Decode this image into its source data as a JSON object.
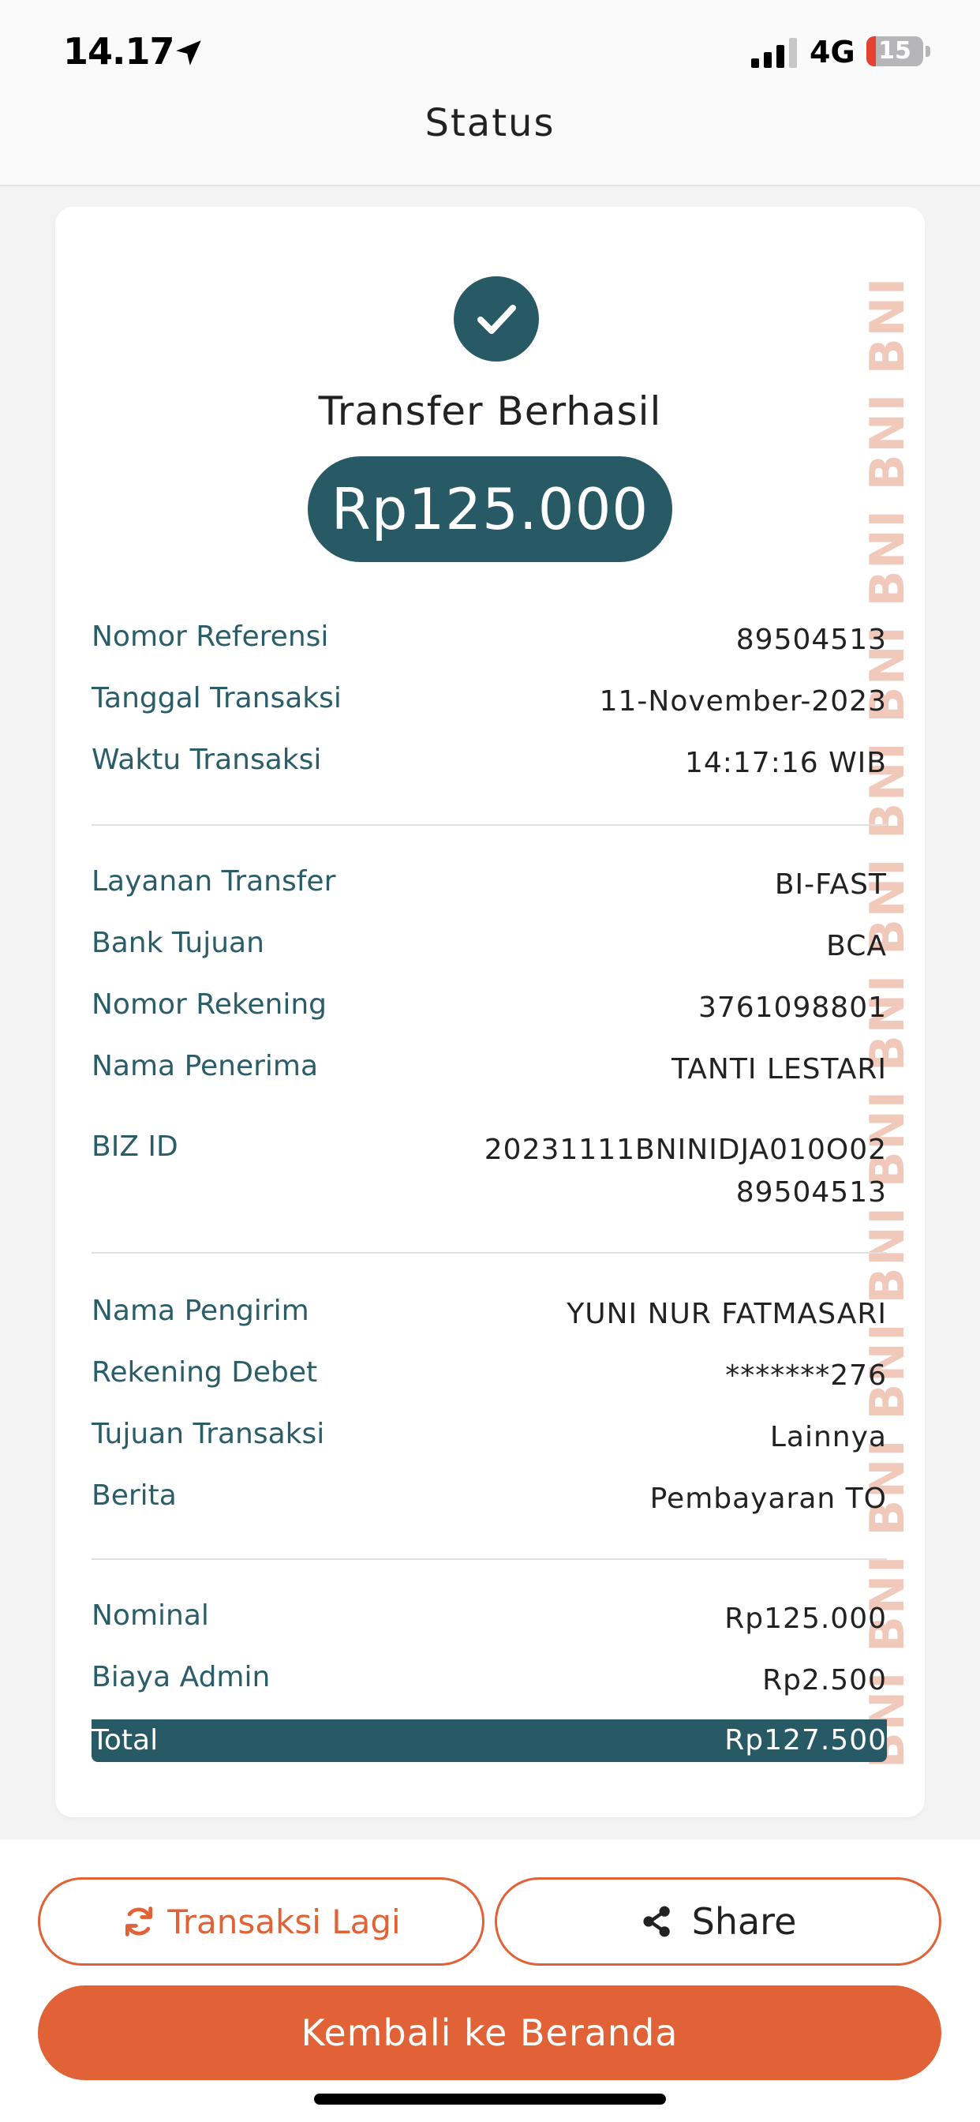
{
  "status_bar": {
    "time": "14.17",
    "network": "4G",
    "battery": "15"
  },
  "header": {
    "title": "Status"
  },
  "receipt": {
    "title": "Transfer Berhasil",
    "amount": "Rp125.000",
    "watermark": "BNI BNI BNI BNI BNI BNI BNI BNI BNI BNI BNI BNI BNI BNI BNI",
    "section1": [
      {
        "label": "Nomor Referensi",
        "value": "89504513"
      },
      {
        "label": "Tanggal Transaksi",
        "value": "11-November-2023"
      },
      {
        "label": "Waktu Transaksi",
        "value": "14:17:16 WIB"
      }
    ],
    "section2": [
      {
        "label": "Layanan Transfer",
        "value": "BI-FAST"
      },
      {
        "label": "Bank Tujuan",
        "value": "BCA"
      },
      {
        "label": "Nomor Rekening",
        "value": "3761098801"
      },
      {
        "label": "Nama Penerima",
        "value": "TANTI LESTARI"
      },
      {
        "label": "BIZ ID",
        "value": "20231111BNINIDJA010O02",
        "value_line2": "89504513"
      }
    ],
    "section3": [
      {
        "label": "Nama Pengirim",
        "value": "YUNI NUR FATMASARI"
      },
      {
        "label": "Rekening Debet",
        "value": "*******276"
      },
      {
        "label": "Tujuan Transaksi",
        "value": "Lainnya"
      },
      {
        "label": "Berita",
        "value": "Pembayaran TO"
      }
    ],
    "section4": [
      {
        "label": "Nominal",
        "value": "Rp125.000"
      },
      {
        "label": "Biaya Admin",
        "value": "Rp2.500"
      }
    ],
    "total": {
      "label": "Total",
      "value": "Rp127.500"
    }
  },
  "actions": {
    "again_label": "Transaksi Lagi",
    "share_label": "Share",
    "home_label": "Kembali ke Beranda"
  },
  "colors": {
    "primary": "#285a66",
    "accent": "#e06236",
    "watermark": "#f1c9bb"
  },
  "icons": {
    "success": "check-circle-icon",
    "again": "refresh-icon",
    "share": "share-icon"
  }
}
